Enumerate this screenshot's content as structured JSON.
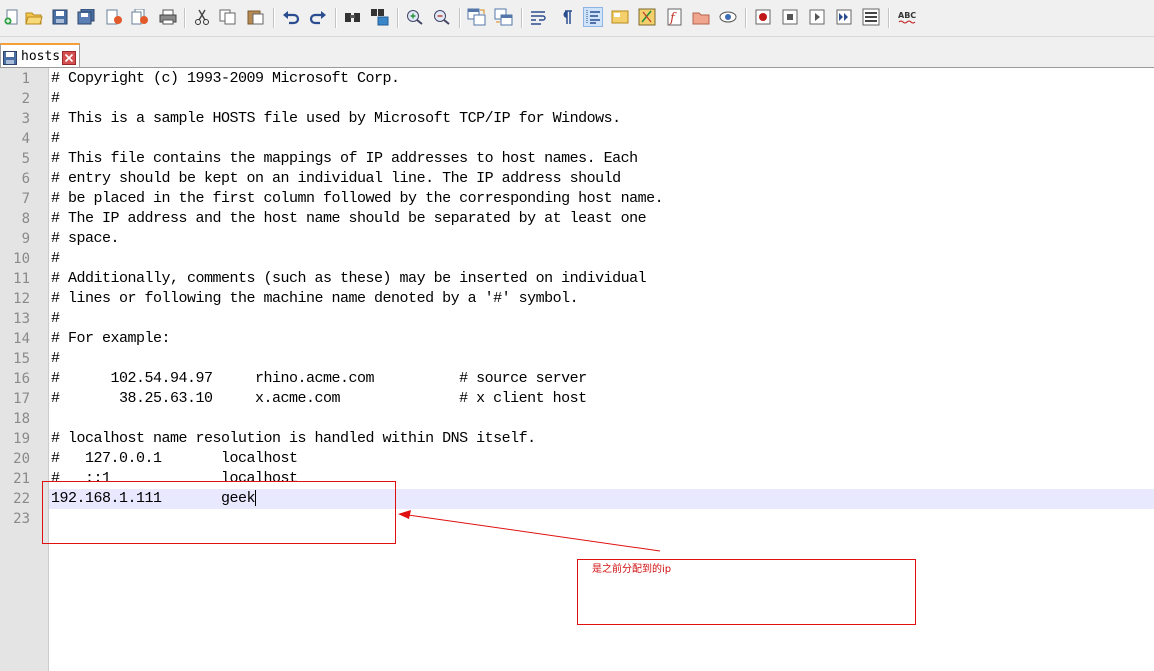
{
  "toolbar": {
    "buttons": [
      "new-file-icon",
      "open-file-icon",
      "save-icon",
      "save-all-icon",
      "close-icon",
      "close-all-icon",
      "print-icon",
      "cut-icon",
      "copy-icon",
      "paste-icon",
      "undo-icon",
      "redo-icon",
      "find-icon",
      "replace-icon",
      "zoom-in-icon",
      "zoom-out-icon",
      "sync-vertical-icon",
      "sync-horizontal-icon",
      "word-wrap-icon",
      "show-all-chars-icon",
      "indent-guide-icon",
      "language-icon",
      "color-icon",
      "function-list-icon",
      "folder-icon",
      "monitor-icon",
      "record-macro-icon",
      "stop-macro-icon",
      "play-macro-icon",
      "run-macro-multiple-icon",
      "save-macro-icon",
      "spellcheck-icon"
    ],
    "spellcheck_text": "ABC"
  },
  "tab": {
    "label": "hosts"
  },
  "editor": {
    "lines": [
      "# Copyright (c) 1993-2009 Microsoft Corp.",
      "#",
      "# This is a sample HOSTS file used by Microsoft TCP/IP for Windows.",
      "#",
      "# This file contains the mappings of IP addresses to host names. Each",
      "# entry should be kept on an individual line. The IP address should",
      "# be placed in the first column followed by the corresponding host name.",
      "# The IP address and the host name should be separated by at least one",
      "# space.",
      "#",
      "# Additionally, comments (such as these) may be inserted on individual",
      "# lines or following the machine name denoted by a '#' symbol.",
      "#",
      "# For example:",
      "#",
      "#      102.54.94.97     rhino.acme.com          # source server",
      "#       38.25.63.10     x.acme.com              # x client host",
      "",
      "# localhost name resolution is handled within DNS itself.",
      "#   127.0.0.1       localhost",
      "#   ::1             localhost",
      "192.168.1.111       geek",
      ""
    ],
    "line_numbers": [
      "1",
      "2",
      "3",
      "4",
      "5",
      "6",
      "7",
      "8",
      "9",
      "10",
      "11",
      "12",
      "13",
      "14",
      "15",
      "16",
      "17",
      "18",
      "19",
      "20",
      "21",
      "22",
      "23"
    ],
    "current_line": 22
  },
  "annotation": {
    "label": "是之前分配到的ip",
    "color": "#e01010"
  },
  "colors": {
    "current_line_bg": "#e8e8ff",
    "tab_accent": "#f59d36",
    "gutter_bg": "#e4e4e4"
  }
}
